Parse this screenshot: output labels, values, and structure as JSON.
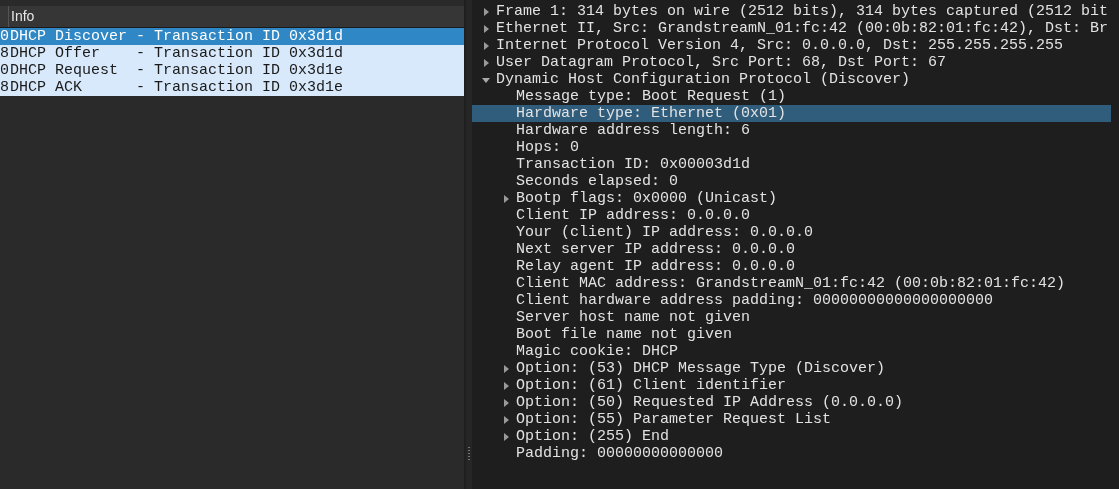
{
  "packet_list": {
    "columns": [
      {
        "label": "Info"
      }
    ],
    "rows": [
      {
        "column_1": "0",
        "info": "DHCP Discover - Transaction ID 0x3d1d",
        "selected": true
      },
      {
        "column_1": "8",
        "info": "DHCP Offer    - Transaction ID 0x3d1d",
        "selected": false
      },
      {
        "column_1": "0",
        "info": "DHCP Request  - Transaction ID 0x3d1e",
        "selected": false
      },
      {
        "column_1": "8",
        "info": "DHCP ACK      - Transaction ID 0x3d1e",
        "selected": false
      }
    ]
  },
  "packet_details": [
    {
      "label": "Frame 1: 314 bytes on wire (2512 bits), 314 bytes captured (2512 bit",
      "expanded": false,
      "selected": false
    },
    {
      "label": "Ethernet II, Src: GrandstreamN_01:fc:42 (00:0b:82:01:fc:42), Dst: Br",
      "expanded": false,
      "selected": false
    },
    {
      "label": "Internet Protocol Version 4, Src: 0.0.0.0, Dst: 255.255.255.255",
      "expanded": false,
      "selected": false
    },
    {
      "label": "User Datagram Protocol, Src Port: 68, Dst Port: 67",
      "expanded": false,
      "selected": false
    },
    {
      "label": "Dynamic Host Configuration Protocol (Discover)",
      "expanded": true,
      "selected": false,
      "children": [
        {
          "label": "Message type: Boot Request (1)",
          "selected": false
        },
        {
          "label": "Hardware type: Ethernet (0x01)",
          "selected": true
        },
        {
          "label": "Hardware address length: 6",
          "selected": false
        },
        {
          "label": "Hops: 0",
          "selected": false
        },
        {
          "label": "Transaction ID: 0x00003d1d",
          "selected": false
        },
        {
          "label": "Seconds elapsed: 0",
          "selected": false
        },
        {
          "label": "Bootp flags: 0x0000 (Unicast)",
          "expanded": false,
          "selected": false
        },
        {
          "label": "Client IP address: 0.0.0.0",
          "selected": false
        },
        {
          "label": "Your (client) IP address: 0.0.0.0",
          "selected": false
        },
        {
          "label": "Next server IP address: 0.0.0.0",
          "selected": false
        },
        {
          "label": "Relay agent IP address: 0.0.0.0",
          "selected": false
        },
        {
          "label": "Client MAC address: GrandstreamN_01:fc:42 (00:0b:82:01:fc:42)",
          "selected": false
        },
        {
          "label": "Client hardware address padding: 00000000000000000000",
          "selected": false
        },
        {
          "label": "Server host name not given",
          "selected": false
        },
        {
          "label": "Boot file name not given",
          "selected": false
        },
        {
          "label": "Magic cookie: DHCP",
          "selected": false
        },
        {
          "label": "Option: (53) DHCP Message Type (Discover)",
          "expanded": false,
          "selected": false
        },
        {
          "label": "Option: (61) Client identifier",
          "expanded": false,
          "selected": false
        },
        {
          "label": "Option: (50) Requested IP Address (0.0.0.0)",
          "expanded": false,
          "selected": false
        },
        {
          "label": "Option: (55) Parameter Request List",
          "expanded": false,
          "selected": false
        },
        {
          "label": "Option: (255) End",
          "expanded": false,
          "selected": false
        },
        {
          "label": "Padding: 00000000000000",
          "selected": false
        }
      ]
    }
  ]
}
